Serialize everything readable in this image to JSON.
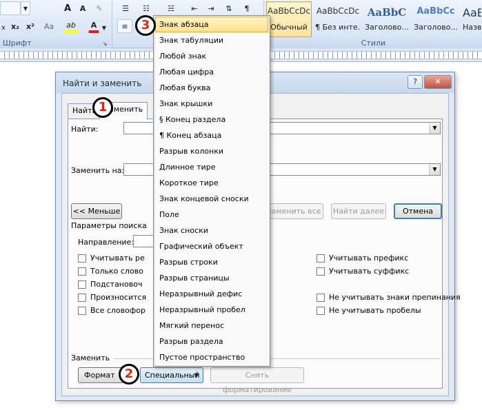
{
  "ribbon": {
    "font_group_label": "Шрифт",
    "styles_group_label": "Стили",
    "styles": [
      {
        "sample": "AaBbCcDc",
        "name": "Обычный",
        "active": true
      },
      {
        "sample": "AaBbCcDc",
        "name": "¶ Без инте..."
      },
      {
        "sample": "AaBbC",
        "name": "Заголово..."
      },
      {
        "sample": "AaBbCc",
        "name": "Заголово..."
      },
      {
        "sample": "AaB",
        "name": "Назв"
      }
    ],
    "buttons": {
      "grow_font": "A",
      "shrink_font": "A",
      "subscript": "x₂",
      "superscript": "x²",
      "case": "Aa",
      "highlight": "ab",
      "font_color": "A",
      "pilcrow": "¶"
    }
  },
  "dialog": {
    "title": "Найти и заменить",
    "help": "?",
    "close": "✕",
    "tabs": [
      "Найти",
      "Заменить"
    ],
    "find_label": "Найти:",
    "replace_label": "Заменить на:",
    "less_button": "<< Меньше",
    "replace_all_button": "Заменить все",
    "find_next_button": "Найти далее",
    "cancel_button": "Отмена",
    "params_label": "Параметры поиска",
    "direction_label": "Направление:",
    "left_options": [
      "Учитывать ре",
      "Только слово",
      "Подстановоч",
      "Произносится",
      "Все словофор"
    ],
    "right_options": [
      "Учитывать префикс",
      "Учитывать суффикс",
      "Не учитывать знаки препинания",
      "Не учитывать пробелы"
    ],
    "replace_section_label": "Заменить",
    "format_button": "Формат",
    "special_button": "Специальный",
    "clear_format_button": "Снять форматирование"
  },
  "menu": {
    "items": [
      "Знак абзаца",
      "Знак табуляции",
      "Любой знак",
      "Любая цифра",
      "Любая буква",
      "Знак крышки",
      "§ Конец раздела",
      "¶ Конец абзаца",
      "Разрыв колонки",
      "Длинное тире",
      "Короткое тире",
      "Знак концевой сноски",
      "Поле",
      "Знак сноски",
      "Графический объект",
      "Разрыв строки",
      "Разрыв страницы",
      "Неразрывный дефис",
      "Неразрывный пробел",
      "Мягкий перенос",
      "Разрыв раздела",
      "Пустое пространство"
    ],
    "highlighted_index": 0
  },
  "annotations": [
    "1",
    "2",
    "3"
  ],
  "colors": {
    "highlight": "#ffe08a",
    "annotation_text": "#e0240f",
    "font_color_bar": "#e21a1a",
    "highlight_bar": "#ffff00"
  }
}
